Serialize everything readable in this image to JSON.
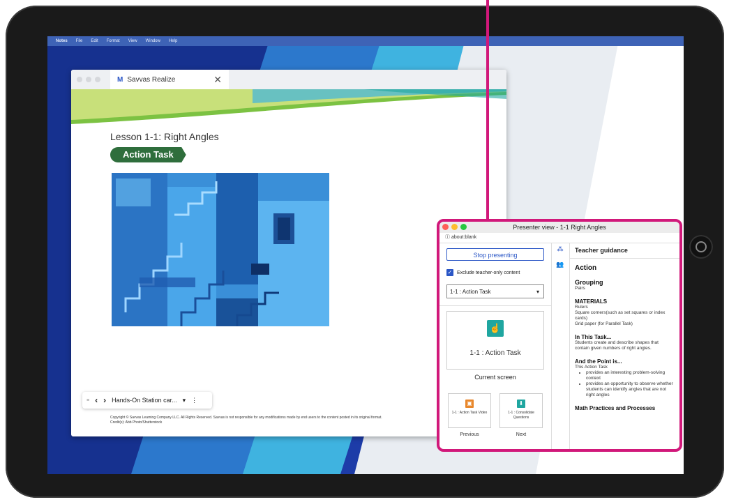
{
  "menubar": {
    "app": "Notes",
    "items": [
      "File",
      "Edit",
      "Format",
      "View",
      "Window",
      "Help"
    ]
  },
  "browser": {
    "tab_logo": "M",
    "tab_title": "Savvas Realize",
    "close_glyph": "✕",
    "lesson_title": "Lesson 1-1: Right Angles",
    "badge": "Action Task",
    "nav": {
      "grip": "≡",
      "prev": "‹",
      "next": "›",
      "station": "Hands-On Station car...",
      "caret": "▾",
      "more": "⋮"
    },
    "copyright_line1": "Copyright © Savvas Learning Company LLC. All Rights Reserved. Savvas is not responsible for any modifications made by end users to the content posted in its original format.",
    "copyright_line2": "Credit(s): Abb Photo/Shutterstock"
  },
  "presenter": {
    "title": "Presenter view - 1-1 Right Angles",
    "url_icon": "ⓘ",
    "url": "about:blank",
    "stop_button": "Stop presenting",
    "check_glyph": "✓",
    "exclude_label": "Exclude teacher-only content",
    "select_value": "1-1 : Action Task",
    "select_caret": "▾",
    "card_icon": "☝",
    "card_label": "1-1 : Action Task",
    "current_label": "Current screen",
    "prev_icon": "▣",
    "prev_card": "1-1 : Action Task Video",
    "prev_label": "Previous",
    "next_icon": "⬇",
    "next_card": "1-1 : Consolidate Questions",
    "next_label": "Next",
    "strip_icon_1": "⁂",
    "strip_icon_2": "👥",
    "guidance_header": "Teacher guidance",
    "section": "Action",
    "grouping_title": "Grouping",
    "grouping_text": "Pairs",
    "materials_title": "MATERIALS",
    "materials_text": "Rulers\nSquare corners(such as set squares or index cards)\nGrid paper (for Parallel Task)",
    "in_task_title": "In This Task...",
    "in_task_text": "Students create and describe shapes that contain given numbers of right angles.",
    "point_title": "And the Point is...",
    "point_intro": "This Action Task",
    "point_items": [
      "provides an interesting problem-solving context",
      "provides an opportunity to observe whether students can identify angles that are not right angles"
    ],
    "practices_title": "Math Practices and Processes"
  },
  "colors": {
    "callout": "#d1187a",
    "badge_green": "#2f6e3c",
    "link_blue": "#2a56c6",
    "icon_teal": "#1fa6a0",
    "icon_orange": "#e8872b"
  }
}
